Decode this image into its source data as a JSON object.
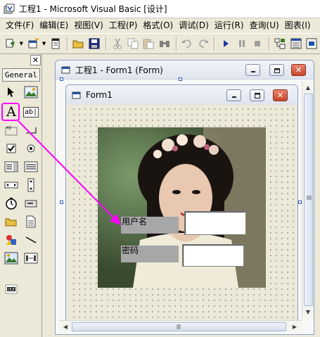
{
  "app": {
    "title": "工程1 - Microsoft Visual Basic [设计]"
  },
  "menu": {
    "items": [
      "文件(F)",
      "编辑(E)",
      "视图(V)",
      "工程(P)",
      "格式(O)",
      "调试(D)",
      "运行(R)",
      "查询(U)",
      "图表(I)"
    ]
  },
  "toolbox": {
    "tab_label": "General",
    "close_label": "✕",
    "label_tool_glyph": "A",
    "textbox_tool_glyph": "ab|"
  },
  "project_window": {
    "title": "工程1 - Form1 (Form)"
  },
  "form_window": {
    "title": "Form1"
  },
  "form": {
    "username_label": "用户名",
    "password_label": "密码",
    "username_value": "",
    "password_value": ""
  },
  "colors": {
    "highlight": "#ff00ff",
    "label_bg": "#a7a7a7"
  }
}
